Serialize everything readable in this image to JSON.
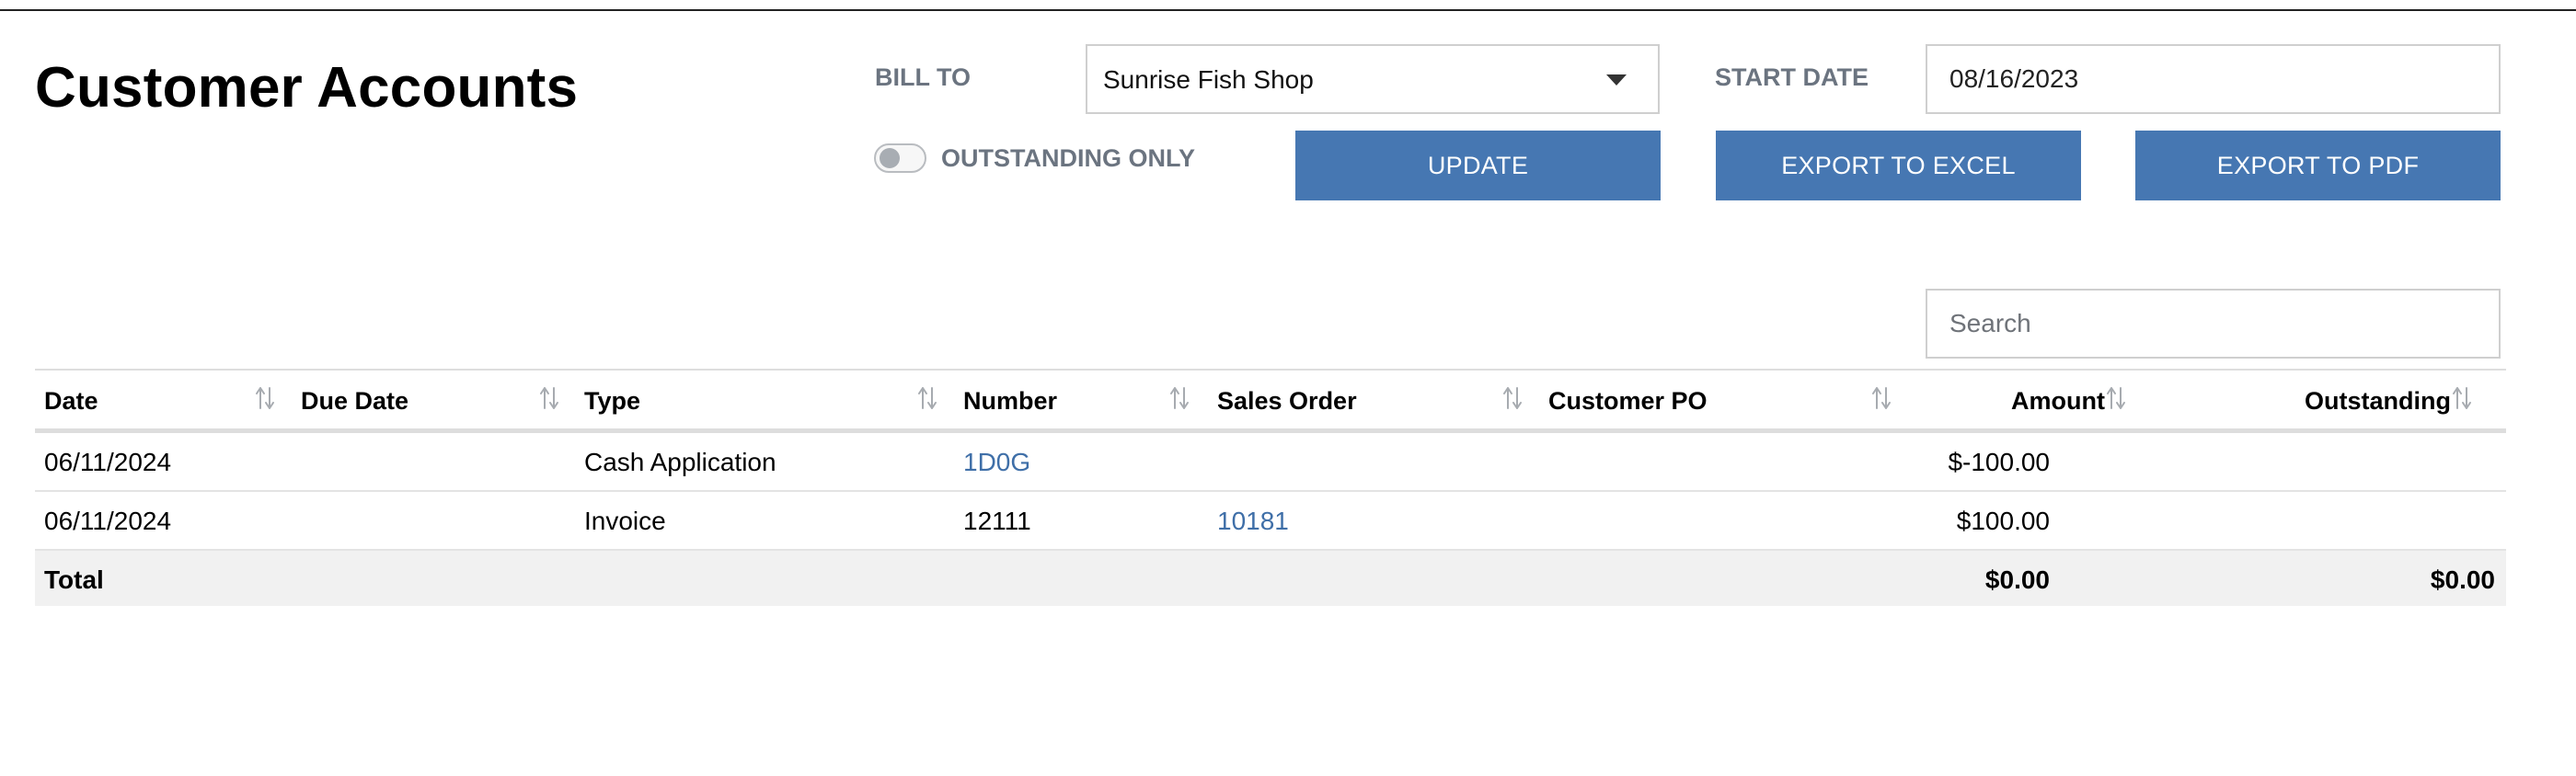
{
  "page": {
    "title": "Customer Accounts"
  },
  "filters": {
    "bill_to_label": "BILL TO",
    "bill_to_value": "Sunrise Fish Shop",
    "start_date_label": "START DATE",
    "start_date_value": "08/16/2023",
    "outstanding_only_label": "OUTSTANDING ONLY",
    "outstanding_only_on": false
  },
  "actions": {
    "update_label": "UPDATE",
    "export_excel_label": "EXPORT TO EXCEL",
    "export_pdf_label": "EXPORT TO PDF"
  },
  "search": {
    "placeholder": "Search"
  },
  "table": {
    "columns": [
      {
        "label": "Date",
        "sort_icon": "sort-arrows-icon"
      },
      {
        "label": "Due Date",
        "sort_icon": "sort-arrows-icon"
      },
      {
        "label": "Type",
        "sort_icon": "sort-arrows-icon"
      },
      {
        "label": "Number",
        "sort_icon": "sort-arrows-icon"
      },
      {
        "label": "Sales Order",
        "sort_icon": "sort-arrows-icon"
      },
      {
        "label": "Customer PO",
        "sort_icon": "sort-arrows-icon"
      },
      {
        "label": "Amount",
        "sort_icon": "sort-arrows-icon"
      },
      {
        "label": "Outstanding",
        "sort_icon": "sort-arrows-icon"
      }
    ],
    "rows": [
      {
        "date": "06/11/2024",
        "due_date": "",
        "type": "Cash Application",
        "number": "1D0G",
        "sales_order": "",
        "customer_po": "",
        "amount": "$-100.00",
        "outstanding": ""
      },
      {
        "date": "06/11/2024",
        "due_date": "",
        "type": "Invoice",
        "number": "12111",
        "sales_order": "10181",
        "customer_po": "",
        "amount": "$100.00",
        "outstanding": ""
      }
    ],
    "total": {
      "label": "Total",
      "amount": "$0.00",
      "outstanding": "$0.00"
    }
  },
  "colors": {
    "button": "#4677b2",
    "link": "#3f6fa8",
    "label_gray": "#6b7480",
    "total_row_bg": "#f1f1f1"
  }
}
